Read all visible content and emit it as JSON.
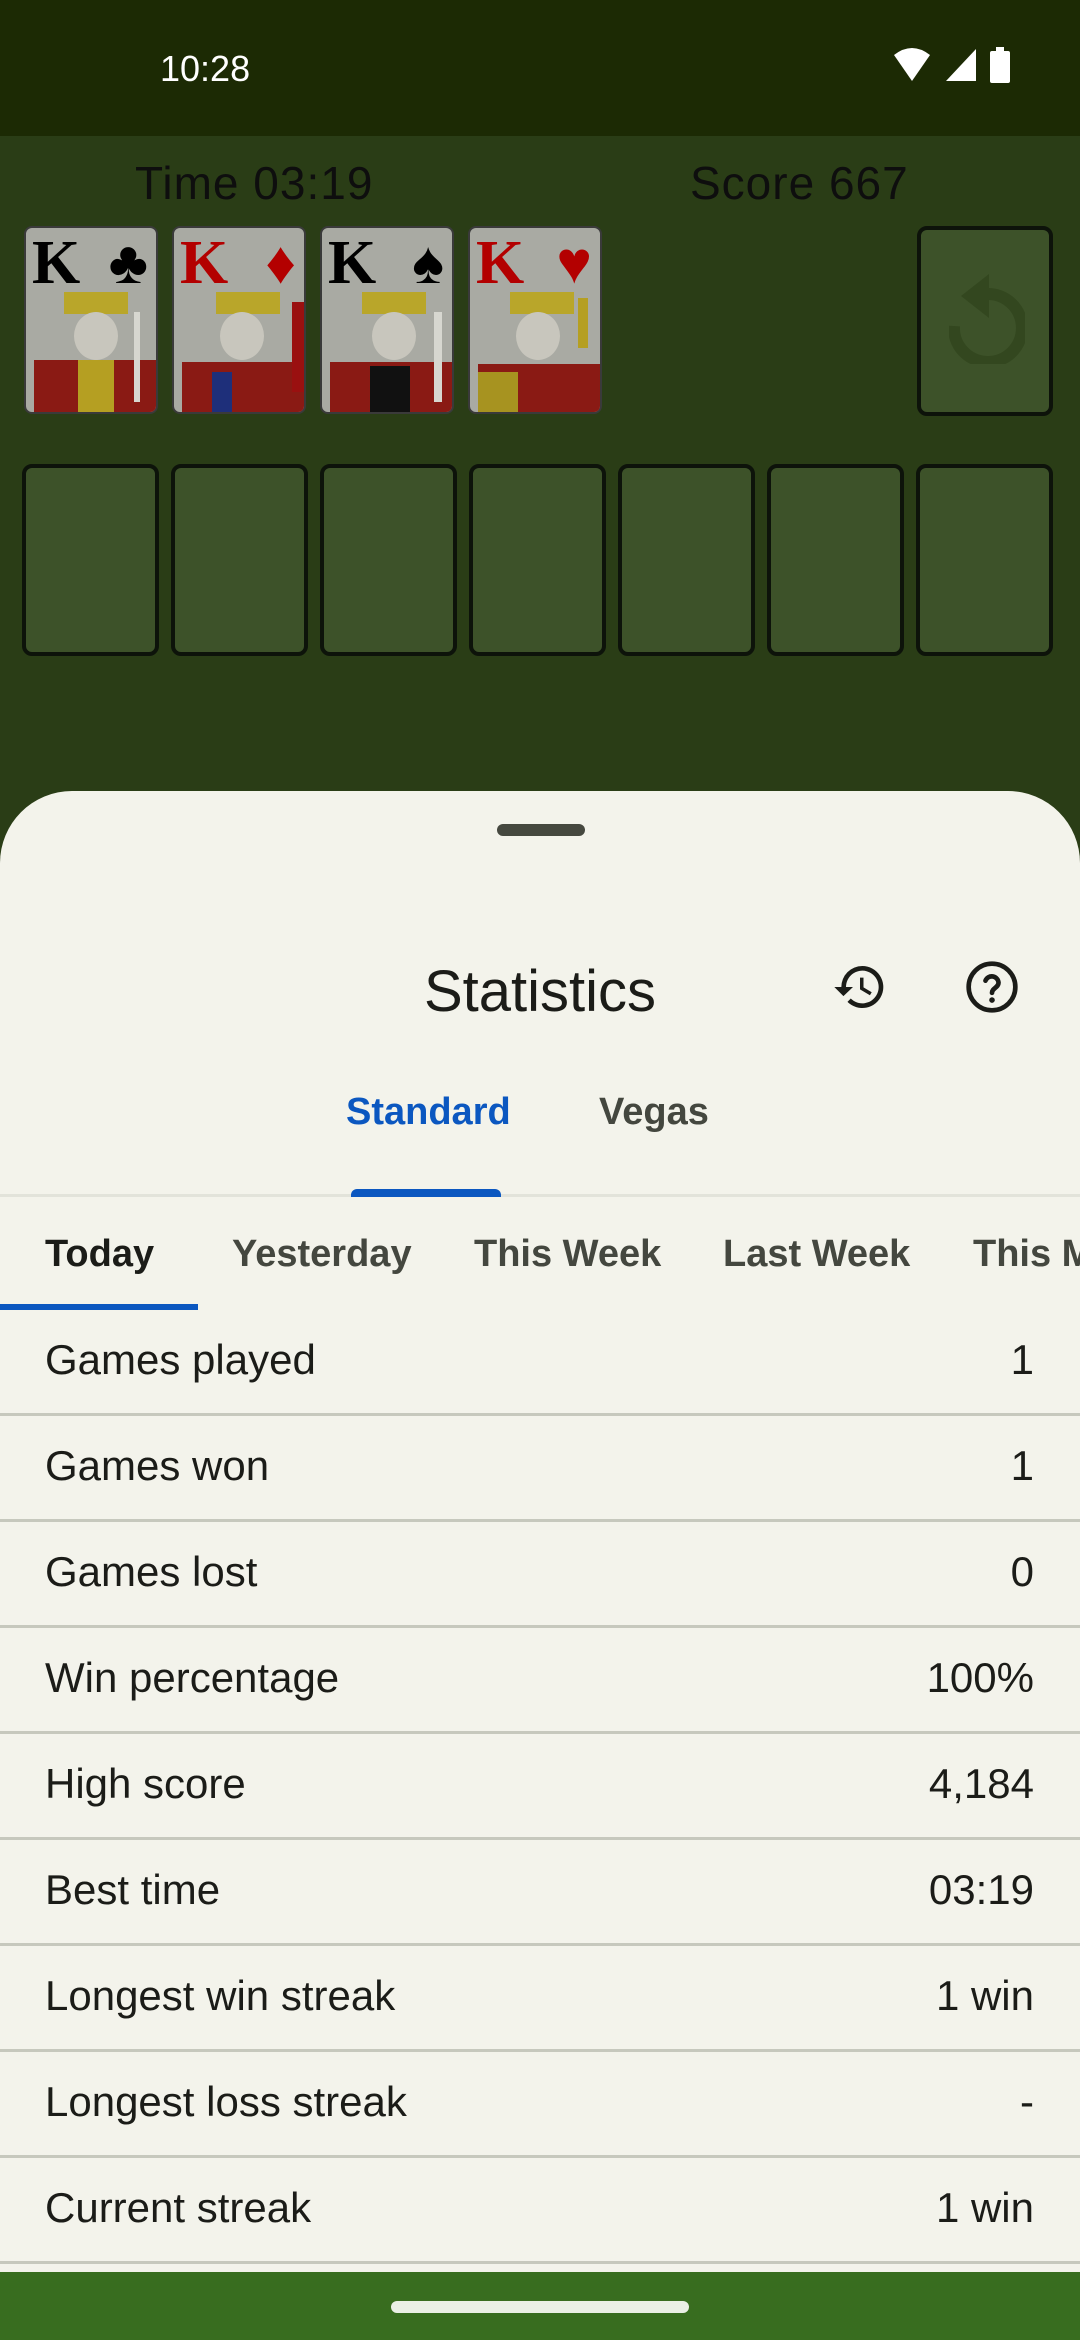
{
  "status_bar": {
    "time": "10:28",
    "icons": [
      "wifi-icon",
      "cellular-signal-icon",
      "battery-icon"
    ]
  },
  "game": {
    "time_label": "Time 03:19",
    "score_label": "Score 667",
    "foundations": [
      {
        "rank": "K",
        "suit": "♣",
        "suit_name": "clubs",
        "color": "#000000"
      },
      {
        "rank": "K",
        "suit": "♦",
        "suit_name": "diamonds",
        "color": "#c00000"
      },
      {
        "rank": "K",
        "suit": "♠",
        "suit_name": "spades",
        "color": "#000000"
      },
      {
        "rank": "K",
        "suit": "♥",
        "suit_name": "hearts",
        "color": "#c00000"
      }
    ],
    "stock_icon": "redeal-icon",
    "tableau_piles": 7
  },
  "sheet": {
    "title": "Statistics",
    "history_icon": "history-icon",
    "help_icon": "help-icon",
    "mode_tabs": [
      {
        "label": "Standard",
        "active": true
      },
      {
        "label": "Vegas",
        "active": false
      }
    ],
    "period_tabs": [
      {
        "label": "Today",
        "active": true
      },
      {
        "label": "Yesterday",
        "active": false
      },
      {
        "label": "This Week",
        "active": false
      },
      {
        "label": "Last Week",
        "active": false
      },
      {
        "label": "This M",
        "active": false
      }
    ],
    "stats": [
      {
        "label": "Games played",
        "value": "1"
      },
      {
        "label": "Games won",
        "value": "1"
      },
      {
        "label": "Games lost",
        "value": "0"
      },
      {
        "label": "Win percentage",
        "value": "100%"
      },
      {
        "label": "High score",
        "value": "4,184"
      },
      {
        "label": "Best time",
        "value": "03:19"
      },
      {
        "label": "Longest win streak",
        "value": "1 win"
      },
      {
        "label": "Longest loss streak",
        "value": "-"
      },
      {
        "label": "Current streak",
        "value": "1 win"
      }
    ]
  },
  "colors": {
    "accent": "#0b57c0",
    "felt": "#2a3d16",
    "sheet_bg": "#f3f3eb",
    "nav_bar": "#386d1f"
  }
}
